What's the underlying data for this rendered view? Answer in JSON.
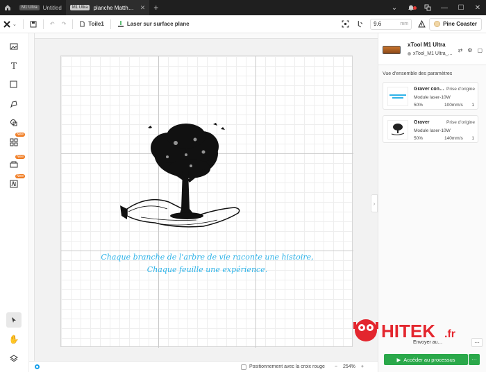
{
  "titlebar": {
    "tabs": [
      {
        "chip": "M1 Ultra",
        "label": "Untitled",
        "active": false
      },
      {
        "chip": "M1 Ultra",
        "label": "planche Matth…",
        "active": true
      }
    ],
    "new_tab": "+"
  },
  "toolbar": {
    "canvas_name": "Toile1",
    "mode_label": "Laser sur surface plane",
    "thickness_value": "9.6",
    "thickness_unit": "mm",
    "material_label": "Pine Coaster"
  },
  "canvas": {
    "caption_line1": "Chaque branche de l'arbre de vie raconte une histoire,",
    "caption_line2": "Chaque feuille une expérience."
  },
  "statusbar": {
    "crosshair_label": "Positionnement avec la croix rouge",
    "zoom_minus": "−",
    "zoom_value": "254%",
    "zoom_plus": "+"
  },
  "left_tools": {
    "new_badge": "New"
  },
  "device": {
    "name": "xTool M1 Ultra",
    "subtitle": "xTool_M1 Ultra_..."
  },
  "panel": {
    "overview_title": "Vue d'ensemble des paramètres",
    "cards": [
      {
        "title": "Graver con…",
        "tag": "Prise d'origine",
        "module": "Module laser-10W",
        "power": "50%",
        "speed": "100mm/s",
        "passes": "1"
      },
      {
        "title": "Graver",
        "tag": "Prise d'origine",
        "module": "Module laser-10W",
        "power": "50%",
        "speed": "140mm/s",
        "passes": "1"
      }
    ],
    "send_label": "Envoyer au…",
    "more": "···",
    "process_label": "Accéder au processus"
  },
  "watermark": {
    "text": "HITEK",
    "suffix": ".fr"
  },
  "colors": {
    "accent_green": "#2aa84a",
    "caption_blue": "#2fb3e8",
    "new_badge": "#f07a1f"
  }
}
